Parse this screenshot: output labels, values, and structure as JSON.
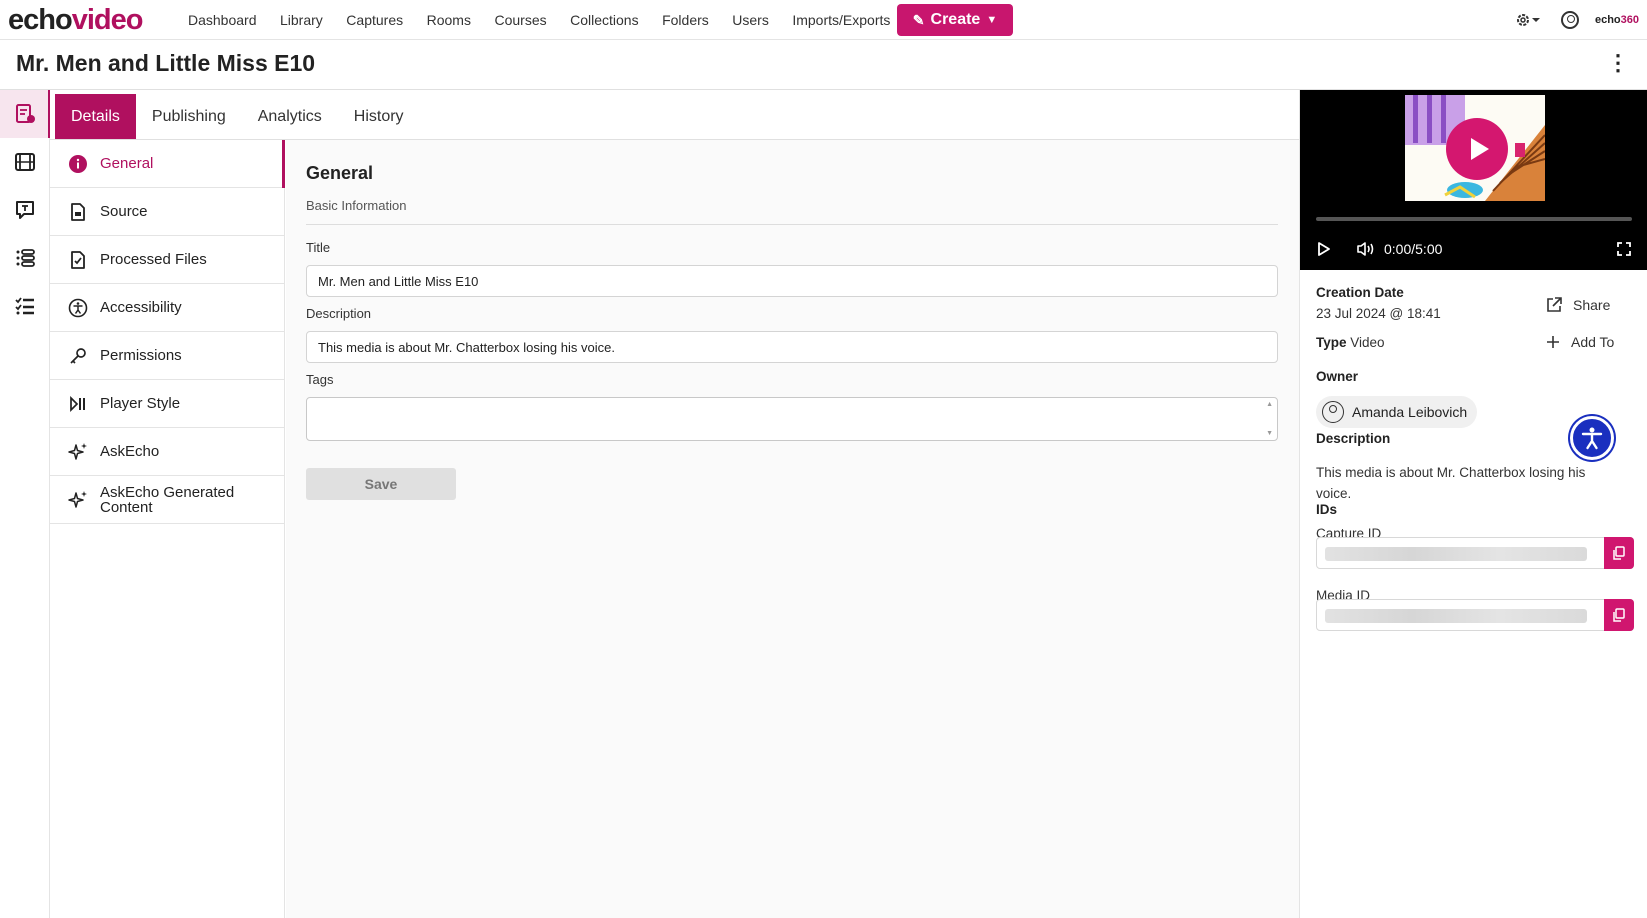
{
  "app": {
    "logo_echo": "echo",
    "logo_video": "video",
    "brand_small_echo": "echo",
    "brand_small_num": "360"
  },
  "nav": {
    "items": [
      "Dashboard",
      "Library",
      "Captures",
      "Rooms",
      "Courses",
      "Collections",
      "Folders",
      "Users",
      "Imports/Exports"
    ],
    "create_label": "Create"
  },
  "page": {
    "title": "Mr. Men and Little Miss E10"
  },
  "tabs": [
    "Details",
    "Publishing",
    "Analytics",
    "History"
  ],
  "submenu": {
    "items": [
      "General",
      "Source",
      "Processed Files",
      "Accessibility",
      "Permissions",
      "Player Style",
      "AskEcho"
    ],
    "generated_line1": "AskEcho Generated",
    "generated_line2": "Content"
  },
  "form": {
    "section_title": "General",
    "section_subtitle": "Basic Information",
    "title_label": "Title",
    "title_value": "Mr. Men and Little Miss E10",
    "description_label": "Description",
    "description_value": "This media is about Mr. Chatterbox losing his voice.",
    "tags_label": "Tags",
    "save_label": "Save"
  },
  "player": {
    "time": "0:00/5:00"
  },
  "info": {
    "creation_date_label": "Creation Date",
    "creation_date_value": "23 Jul 2024 @ 18:41",
    "type_label": "Type",
    "type_value": "Video",
    "share_label": "Share",
    "add_to_label": "Add To",
    "owner_label": "Owner",
    "owner_name": "Amanda Leibovich",
    "description_label": "Description",
    "description_value": "This media is about Mr. Chatterbox losing his voice.",
    "ids_label": "IDs",
    "capture_id_label": "Capture ID",
    "media_id_label": "Media ID"
  },
  "colors": {
    "brand": "#b0105f",
    "create_bg": "#c8166e",
    "accessibility": "#1a2fbf"
  }
}
